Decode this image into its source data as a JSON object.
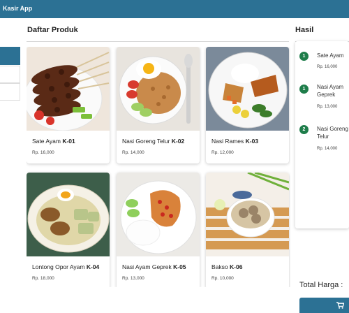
{
  "app": {
    "title": "Kasir App"
  },
  "colors": {
    "primary": "#2c7194",
    "qty_badge": "#1e7d4a"
  },
  "products_section": {
    "title": "Daftar Produk"
  },
  "products": [
    {
      "name": "Sate Ayam",
      "code": "K-01",
      "price": "Rp. 16,000",
      "image": "sate-ayam-photo"
    },
    {
      "name": "Nasi Goreng Telur",
      "code": "K-02",
      "price": "Rp. 14,000",
      "image": "nasi-goreng-telur-photo"
    },
    {
      "name": "Nasi Rames",
      "code": "K-03",
      "price": "Rp. 12,000",
      "image": "nasi-rames-photo"
    },
    {
      "name": "Lontong Opor Ayam",
      "code": "K-04",
      "price": "Rp. 18,000",
      "image": "lontong-opor-photo"
    },
    {
      "name": "Nasi Ayam Geprek",
      "code": "K-05",
      "price": "Rp. 13,000",
      "image": "nasi-ayam-geprek-photo"
    },
    {
      "name": "Bakso",
      "code": "K-06",
      "price": "Rp. 10,000",
      "image": "bakso-photo"
    }
  ],
  "cart": {
    "title": "Hasil",
    "items": [
      {
        "qty": "1",
        "name": "Sate Ayam",
        "price": "Rp. 16,000"
      },
      {
        "qty": "1",
        "name": "Nasi Ayam Geprek",
        "price": "Rp. 13,000"
      },
      {
        "qty": "2",
        "name": "Nasi Goreng Telur",
        "price": "Rp. 14,000"
      }
    ]
  },
  "total": {
    "label": "Total Harga :"
  },
  "pay_button": {
    "icon": "shopping-cart-icon"
  }
}
